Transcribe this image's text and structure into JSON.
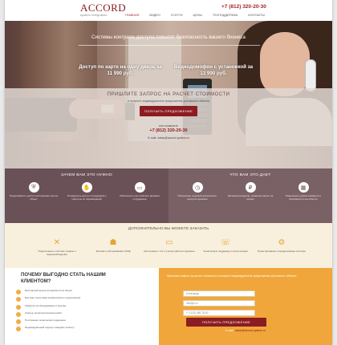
{
  "header": {
    "logo_text": "ACCORD",
    "logo_sub": "system integration",
    "phone": "+7 (812) 320-20-30",
    "nav": [
      "ГЛАВНАЯ",
      "ВИДЕО",
      "УСЛУГИ",
      "ЦЕНЫ",
      "ТЕХПОДДЕРЖКА",
      "КОНТАКТЫ"
    ]
  },
  "hero": {
    "tagline": "Системы контроля доступа повысят безопасность вашего бизнеса",
    "offer_left": "Доступ по карте на одну дверь за 11 990 руб.",
    "offer_right": "Видеодомофон с установкой за 13 990 руб.",
    "calc_title": "ПРИШЛИТЕ ЗАПРОС НА РАСЧЕТ СТОИМОСТИ",
    "calc_sub": "и получите индивидуальное предложение для вашего объекта",
    "button": "ПОЛУЧИТЬ ПРЕДЛОЖЕНИЕ",
    "or": "или позвоните",
    "phone": "+7 (812) 320-20-30",
    "email": "E-mail: zakaz@accord-system.ru"
  },
  "why_need": {
    "title": "ЗАЧЕМ ВАМ ЭТО НУЖНО",
    "items": [
      {
        "icon": "shield-icon",
        "text": "Предотвратить доступ посторонних лиц на объект"
      },
      {
        "icon": "handshake-icon",
        "text": "Упорядочить доступ сотрудников и контроль их перемещений"
      },
      {
        "icon": "computer-icon",
        "text": "Обеспечить учет рабочего времени сотрудников"
      }
    ]
  },
  "what_get": {
    "title": "ЧТО ВАМ ЭТО ДАЕТ",
    "items": [
      {
        "icon": "clock-icon",
        "text": "Повышение трудовой дисциплины, контроль времени"
      },
      {
        "icon": "ruble-icon",
        "text": "Экономия ресурсов, снижение затрат на охрану"
      },
      {
        "icon": "chart-icon",
        "text": "Повышение уровня комфорта и безопасности на объекте"
      }
    ]
  },
  "extra": {
    "title": "ДОПОЛНИТЕЛЬНО ВЫ МОЖЕТЕ ЗАКАЗАТЬ",
    "items": [
      {
        "icon": "tools-icon",
        "text": "Подключение к системе охраны и видеонаблюдения"
      },
      {
        "icon": "worker-icon",
        "text": "Монтаж и обслуживание СКУД"
      },
      {
        "icon": "laptop-icon",
        "text": "Интеграцию с 1С и учетом рабочего времени"
      },
      {
        "icon": "phone-icon",
        "text": "Техническую поддержку и консультации"
      },
      {
        "icon": "gear-icon",
        "text": "Проектирование и модернизацию системы"
      }
    ]
  },
  "why_us": {
    "title": "ПОЧЕМУ ВЫГОДНО СТАТЬ НАШИМ КЛИЕНТОМ?",
    "items": [
      "Бесплатный выезд специалиста на объект",
      "Быстрая подготовка коммерческого предложения",
      "Гарантия на оборудование и монтаж",
      "Сжатые сроки выполнения работ",
      "Постоянная техническая поддержка",
      "Индивидуальный подход к каждому клиенту"
    ]
  },
  "form": {
    "intro": "Пришлите запрос на расчет стоимости и получите индивидуальное предложение для вашего объекта",
    "name_placeholder": "Александр",
    "email_placeholder": "info@pr.ru",
    "phone_placeholder": "+7 (123) 456-78-90",
    "button": "ПОЛУЧИТЬ ПРЕДЛОЖЕНИЕ",
    "email_label": "E-mail:",
    "email_value": "zakaz@accord-system.ru"
  },
  "colors": {
    "brand_red": "#8b1c22",
    "accent_orange": "#f0a63a",
    "band_dark": "#6a5157",
    "band_cream": "#f8f0dc"
  }
}
